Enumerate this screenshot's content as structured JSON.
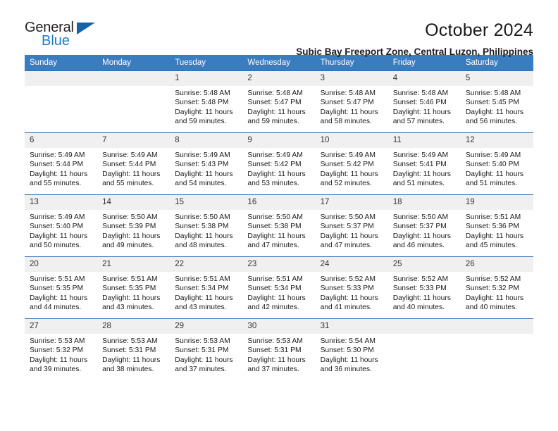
{
  "logo": {
    "word_top": "General",
    "word_bottom": "Blue",
    "triangle_color": "#1264a8",
    "blue_color": "#1f7ac4"
  },
  "header": {
    "month_title": "October 2024",
    "location": "Subic Bay Freeport Zone, Central Luzon, Philippines",
    "header_bg_color": "#3a7cc0",
    "row_border_color": "#2f6fb5",
    "daynum_bg_color": "#f0f0f0"
  },
  "weekday_headers": [
    "Sunday",
    "Monday",
    "Tuesday",
    "Wednesday",
    "Thursday",
    "Friday",
    "Saturday"
  ],
  "labels": {
    "sunrise_prefix": "Sunrise:",
    "sunset_prefix": "Sunset:",
    "daylight_prefix": "Daylight:"
  },
  "weeks": [
    [
      {
        "day": "",
        "empty": true
      },
      {
        "day": "",
        "empty": true
      },
      {
        "day": "1",
        "sunrise": "Sunrise: 5:48 AM",
        "sunset": "Sunset: 5:48 PM",
        "daylight_1": "Daylight: 11 hours",
        "daylight_2": "and 59 minutes."
      },
      {
        "day": "2",
        "sunrise": "Sunrise: 5:48 AM",
        "sunset": "Sunset: 5:47 PM",
        "daylight_1": "Daylight: 11 hours",
        "daylight_2": "and 59 minutes."
      },
      {
        "day": "3",
        "sunrise": "Sunrise: 5:48 AM",
        "sunset": "Sunset: 5:47 PM",
        "daylight_1": "Daylight: 11 hours",
        "daylight_2": "and 58 minutes."
      },
      {
        "day": "4",
        "sunrise": "Sunrise: 5:48 AM",
        "sunset": "Sunset: 5:46 PM",
        "daylight_1": "Daylight: 11 hours",
        "daylight_2": "and 57 minutes."
      },
      {
        "day": "5",
        "sunrise": "Sunrise: 5:48 AM",
        "sunset": "Sunset: 5:45 PM",
        "daylight_1": "Daylight: 11 hours",
        "daylight_2": "and 56 minutes."
      }
    ],
    [
      {
        "day": "6",
        "sunrise": "Sunrise: 5:49 AM",
        "sunset": "Sunset: 5:44 PM",
        "daylight_1": "Daylight: 11 hours",
        "daylight_2": "and 55 minutes."
      },
      {
        "day": "7",
        "sunrise": "Sunrise: 5:49 AM",
        "sunset": "Sunset: 5:44 PM",
        "daylight_1": "Daylight: 11 hours",
        "daylight_2": "and 55 minutes."
      },
      {
        "day": "8",
        "sunrise": "Sunrise: 5:49 AM",
        "sunset": "Sunset: 5:43 PM",
        "daylight_1": "Daylight: 11 hours",
        "daylight_2": "and 54 minutes."
      },
      {
        "day": "9",
        "sunrise": "Sunrise: 5:49 AM",
        "sunset": "Sunset: 5:42 PM",
        "daylight_1": "Daylight: 11 hours",
        "daylight_2": "and 53 minutes."
      },
      {
        "day": "10",
        "sunrise": "Sunrise: 5:49 AM",
        "sunset": "Sunset: 5:42 PM",
        "daylight_1": "Daylight: 11 hours",
        "daylight_2": "and 52 minutes."
      },
      {
        "day": "11",
        "sunrise": "Sunrise: 5:49 AM",
        "sunset": "Sunset: 5:41 PM",
        "daylight_1": "Daylight: 11 hours",
        "daylight_2": "and 51 minutes."
      },
      {
        "day": "12",
        "sunrise": "Sunrise: 5:49 AM",
        "sunset": "Sunset: 5:40 PM",
        "daylight_1": "Daylight: 11 hours",
        "daylight_2": "and 51 minutes."
      }
    ],
    [
      {
        "day": "13",
        "sunrise": "Sunrise: 5:49 AM",
        "sunset": "Sunset: 5:40 PM",
        "daylight_1": "Daylight: 11 hours",
        "daylight_2": "and 50 minutes."
      },
      {
        "day": "14",
        "sunrise": "Sunrise: 5:50 AM",
        "sunset": "Sunset: 5:39 PM",
        "daylight_1": "Daylight: 11 hours",
        "daylight_2": "and 49 minutes."
      },
      {
        "day": "15",
        "sunrise": "Sunrise: 5:50 AM",
        "sunset": "Sunset: 5:38 PM",
        "daylight_1": "Daylight: 11 hours",
        "daylight_2": "and 48 minutes."
      },
      {
        "day": "16",
        "sunrise": "Sunrise: 5:50 AM",
        "sunset": "Sunset: 5:38 PM",
        "daylight_1": "Daylight: 11 hours",
        "daylight_2": "and 47 minutes."
      },
      {
        "day": "17",
        "sunrise": "Sunrise: 5:50 AM",
        "sunset": "Sunset: 5:37 PM",
        "daylight_1": "Daylight: 11 hours",
        "daylight_2": "and 47 minutes."
      },
      {
        "day": "18",
        "sunrise": "Sunrise: 5:50 AM",
        "sunset": "Sunset: 5:37 PM",
        "daylight_1": "Daylight: 11 hours",
        "daylight_2": "and 46 minutes."
      },
      {
        "day": "19",
        "sunrise": "Sunrise: 5:51 AM",
        "sunset": "Sunset: 5:36 PM",
        "daylight_1": "Daylight: 11 hours",
        "daylight_2": "and 45 minutes."
      }
    ],
    [
      {
        "day": "20",
        "sunrise": "Sunrise: 5:51 AM",
        "sunset": "Sunset: 5:35 PM",
        "daylight_1": "Daylight: 11 hours",
        "daylight_2": "and 44 minutes."
      },
      {
        "day": "21",
        "sunrise": "Sunrise: 5:51 AM",
        "sunset": "Sunset: 5:35 PM",
        "daylight_1": "Daylight: 11 hours",
        "daylight_2": "and 43 minutes."
      },
      {
        "day": "22",
        "sunrise": "Sunrise: 5:51 AM",
        "sunset": "Sunset: 5:34 PM",
        "daylight_1": "Daylight: 11 hours",
        "daylight_2": "and 43 minutes."
      },
      {
        "day": "23",
        "sunrise": "Sunrise: 5:51 AM",
        "sunset": "Sunset: 5:34 PM",
        "daylight_1": "Daylight: 11 hours",
        "daylight_2": "and 42 minutes."
      },
      {
        "day": "24",
        "sunrise": "Sunrise: 5:52 AM",
        "sunset": "Sunset: 5:33 PM",
        "daylight_1": "Daylight: 11 hours",
        "daylight_2": "and 41 minutes."
      },
      {
        "day": "25",
        "sunrise": "Sunrise: 5:52 AM",
        "sunset": "Sunset: 5:33 PM",
        "daylight_1": "Daylight: 11 hours",
        "daylight_2": "and 40 minutes."
      },
      {
        "day": "26",
        "sunrise": "Sunrise: 5:52 AM",
        "sunset": "Sunset: 5:32 PM",
        "daylight_1": "Daylight: 11 hours",
        "daylight_2": "and 40 minutes."
      }
    ],
    [
      {
        "day": "27",
        "sunrise": "Sunrise: 5:53 AM",
        "sunset": "Sunset: 5:32 PM",
        "daylight_1": "Daylight: 11 hours",
        "daylight_2": "and 39 minutes."
      },
      {
        "day": "28",
        "sunrise": "Sunrise: 5:53 AM",
        "sunset": "Sunset: 5:31 PM",
        "daylight_1": "Daylight: 11 hours",
        "daylight_2": "and 38 minutes."
      },
      {
        "day": "29",
        "sunrise": "Sunrise: 5:53 AM",
        "sunset": "Sunset: 5:31 PM",
        "daylight_1": "Daylight: 11 hours",
        "daylight_2": "and 37 minutes."
      },
      {
        "day": "30",
        "sunrise": "Sunrise: 5:53 AM",
        "sunset": "Sunset: 5:31 PM",
        "daylight_1": "Daylight: 11 hours",
        "daylight_2": "and 37 minutes."
      },
      {
        "day": "31",
        "sunrise": "Sunrise: 5:54 AM",
        "sunset": "Sunset: 5:30 PM",
        "daylight_1": "Daylight: 11 hours",
        "daylight_2": "and 36 minutes."
      },
      {
        "day": "",
        "empty": true
      },
      {
        "day": "",
        "empty": true
      }
    ]
  ]
}
